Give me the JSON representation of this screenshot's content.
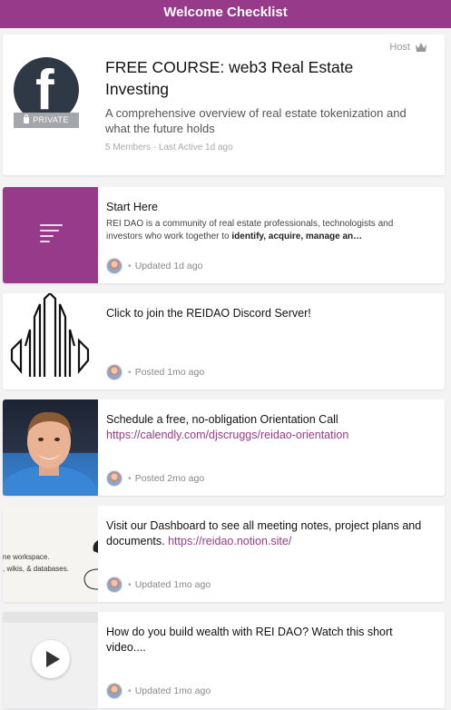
{
  "topbar": {
    "title": "Welcome Checklist"
  },
  "course": {
    "host_label": "Host",
    "private_label": "PRIVATE",
    "title": "FREE COURSE: web3 Real Estate Investing",
    "description": "A comprehensive overview of real estate tokenization and what the future holds",
    "meta": "5 Members · Last Active 1d ago"
  },
  "posts": [
    {
      "title": "Start Here",
      "body_plain": "REI DAO is a community of real estate professionals, technologists and investors who work together to ",
      "body_bold": "identify, acquire, manage an…",
      "status": "Updated 1d ago",
      "thumb_icon": "text-lines-icon"
    },
    {
      "title": "Click to join the REIDAO Discord Server!",
      "status": "Posted 1mo ago",
      "thumb_icon": "skyline-logo-icon"
    },
    {
      "title": "Schedule a free, no-obligation Orientation Call",
      "link": "https://calendly.com/djscruggs/reidao-orientation",
      "status": "Posted 2mo ago"
    },
    {
      "title": "Visit our Dashboard to see all meeting notes, project plans and documents.",
      "link": "https://reidao.notion.site/",
      "status": "Updated 1mo ago",
      "thumb_text_1": "ne workspace.",
      "thumb_text_2": ", wikis, & databases."
    },
    {
      "title": "How do you build wealth with REI DAO? Watch this short video....",
      "status": "Updated 1mo ago",
      "thumb_icon": "play-icon"
    }
  ],
  "colors": {
    "brand": "#983a8a",
    "background": "#f3f3f4",
    "card": "#ffffff"
  }
}
